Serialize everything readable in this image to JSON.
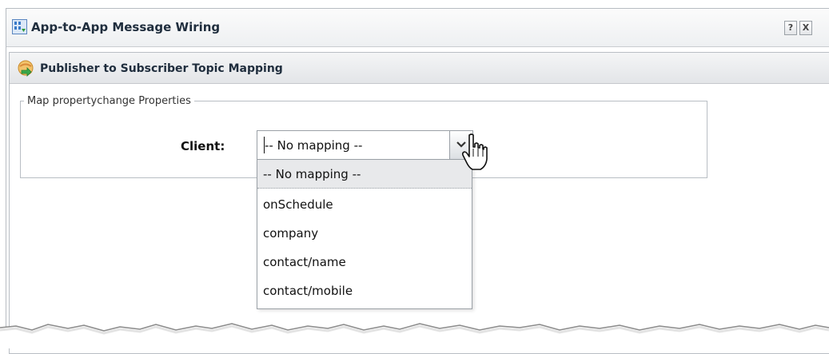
{
  "window": {
    "title": "App-to-App Message Wiring",
    "icon": "wiring-app-icon",
    "help_label": "?",
    "close_label": "X"
  },
  "panel": {
    "title": "Publisher to Subscriber Topic Mapping",
    "icon": "mapping-globe-icon"
  },
  "fieldset": {
    "legend": "Map propertychange Properties"
  },
  "client": {
    "label": "Client:",
    "selected_value": "-- No mapping --"
  },
  "dropdown": {
    "options": [
      "-- No mapping --",
      "onSchedule",
      "company",
      "contact/name",
      "contact/mobile"
    ],
    "highlighted_index": 0
  },
  "colors": {
    "accent_blue": "#3a7bc8",
    "highlight": "#e8e9eb",
    "border": "#9aa0a6"
  }
}
